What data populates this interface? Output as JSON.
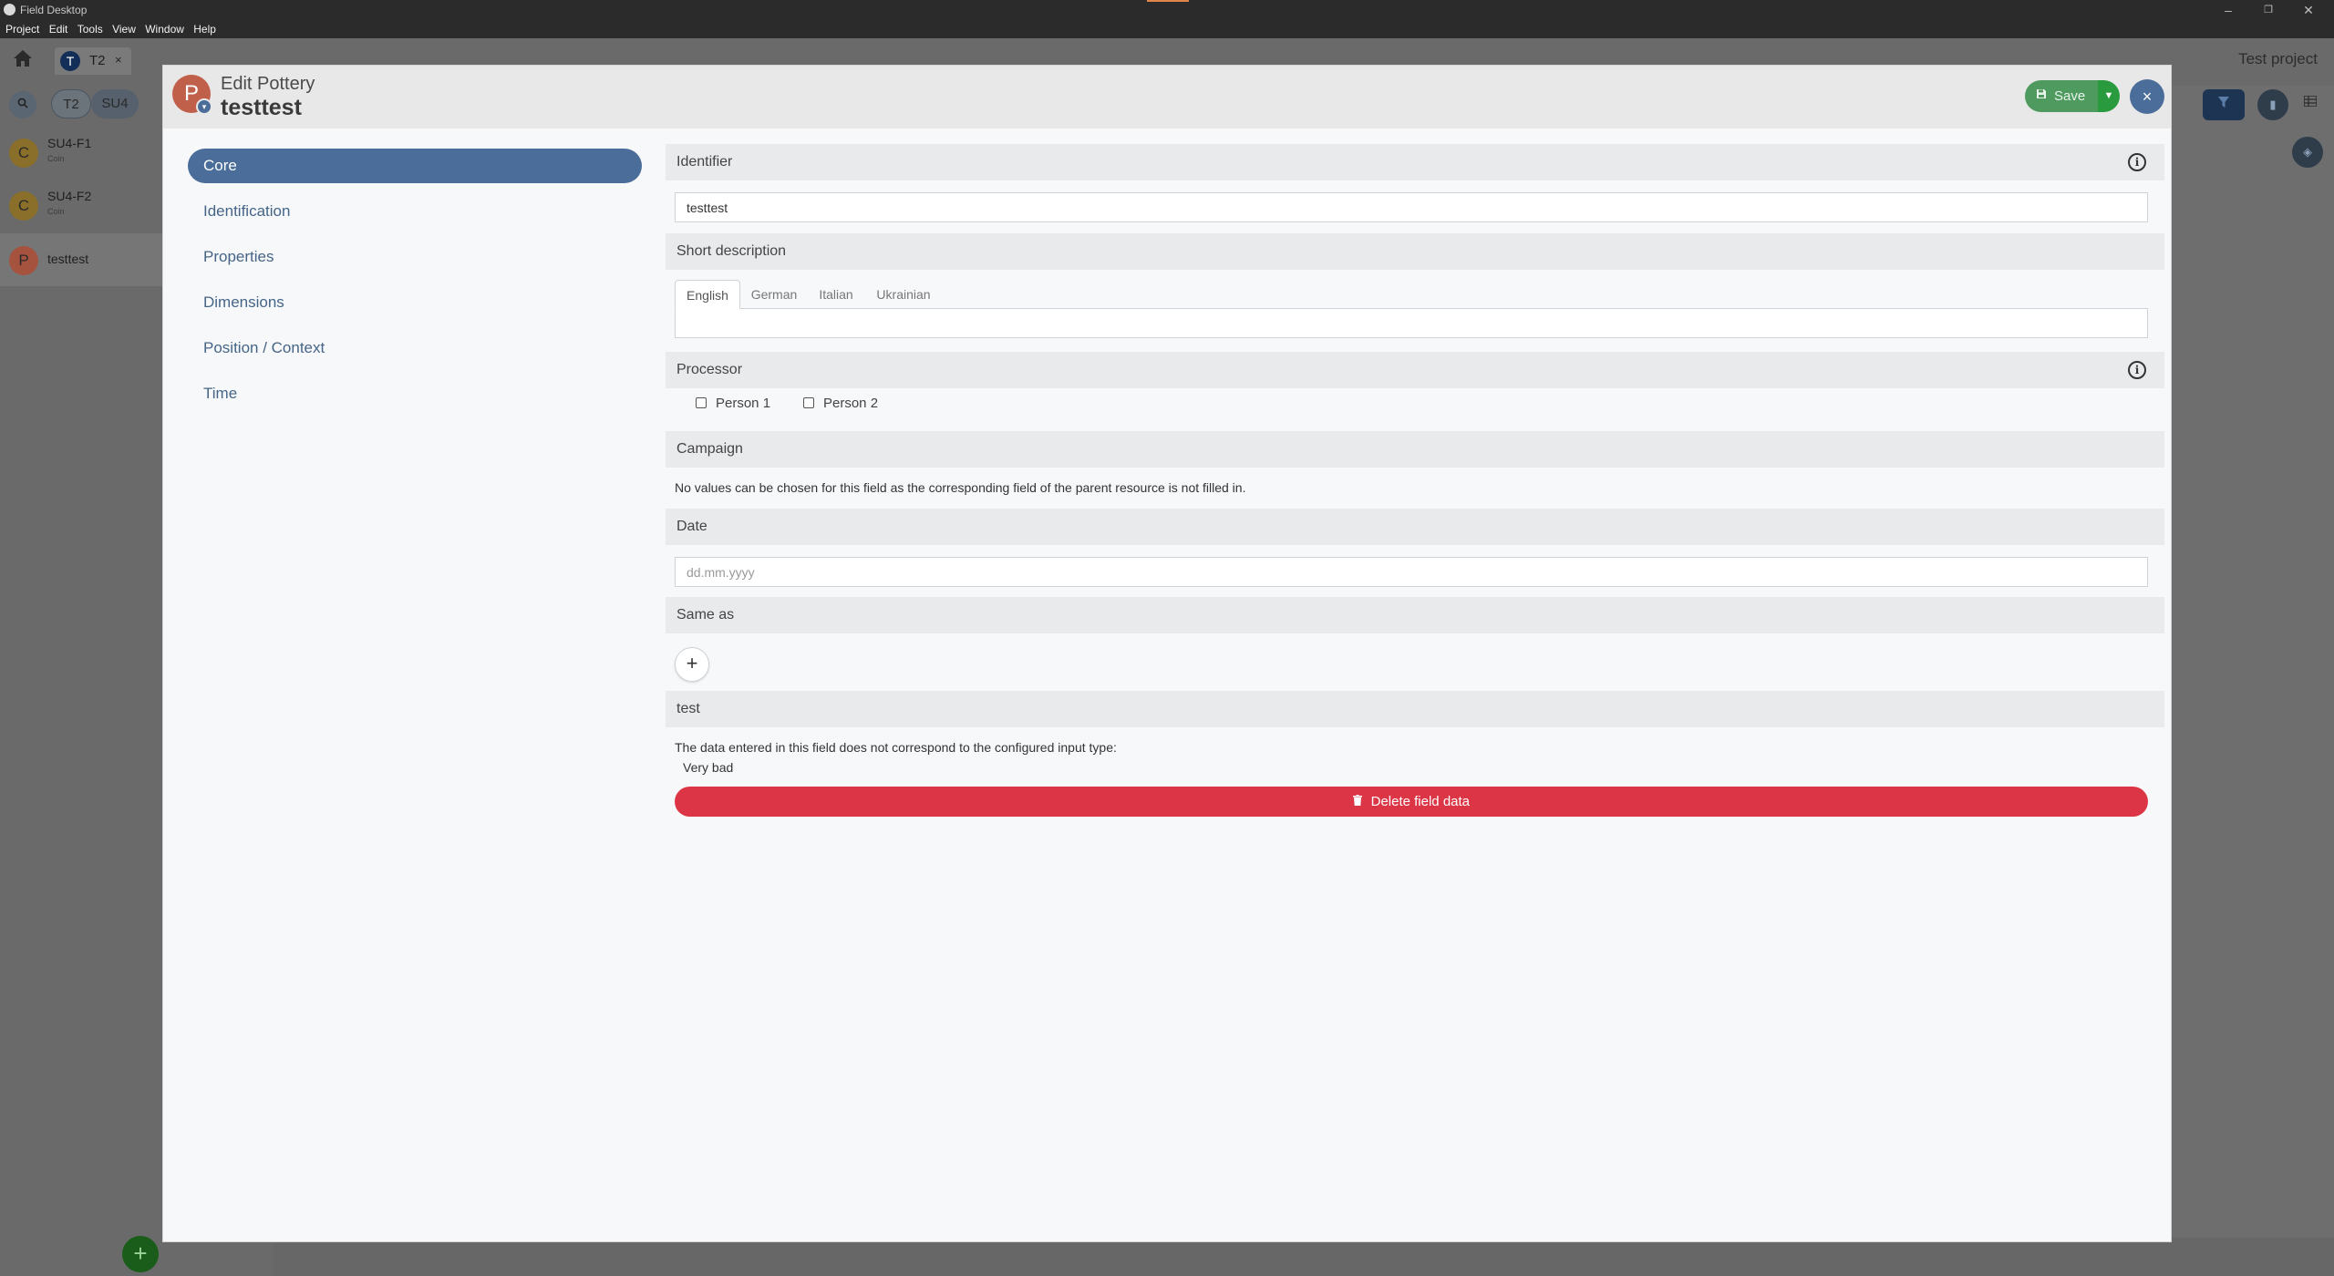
{
  "window": {
    "app_title": "Field Desktop",
    "menu": [
      "Project",
      "Edit",
      "Tools",
      "View",
      "Window",
      "Help"
    ],
    "controls": [
      "minimize-icon",
      "restore-icon",
      "close-icon"
    ]
  },
  "background": {
    "project_tab": {
      "badge": "T",
      "label": "T2",
      "close": "×"
    },
    "project_name": "Test project",
    "breadcrumbs": [
      "T2",
      "SU4"
    ],
    "list": [
      {
        "badge": "C",
        "title": "SU4-F1",
        "subtitle": "Coin",
        "color": "#8a6f2a"
      },
      {
        "badge": "C",
        "title": "SU4-F2",
        "subtitle": "Coin",
        "color": "#8a6f2a"
      },
      {
        "badge": "P",
        "title": "testtest",
        "subtitle": "",
        "color": "#a5533f"
      }
    ],
    "add_button": "+"
  },
  "modal": {
    "header": {
      "category_badge": "P",
      "type_label": "Edit Pottery",
      "identifier": "testtest",
      "save_label": "Save",
      "close_label": "×"
    },
    "groups": [
      "Core",
      "Identification",
      "Properties",
      "Dimensions",
      "Position / Context",
      "Time"
    ],
    "active_group": "Core",
    "fields": {
      "identifier": {
        "label": "Identifier",
        "value": "testtest"
      },
      "short_description": {
        "label": "Short description",
        "languages": [
          "English",
          "German",
          "Italian",
          "Ukrainian"
        ],
        "active_language": "English",
        "value": ""
      },
      "processor": {
        "label": "Processor",
        "options": [
          "Person 1",
          "Person 2"
        ]
      },
      "campaign": {
        "label": "Campaign",
        "message": "No values can be chosen for this field as the corresponding field of the parent resource is not filled in."
      },
      "date": {
        "label": "Date",
        "placeholder": "dd.mm.yyyy",
        "value": ""
      },
      "same_as": {
        "label": "Same as",
        "add_label": "+"
      },
      "test": {
        "label": "test",
        "message": "The data entered in this field does not correspond to the configured input type:",
        "value": "Very bad",
        "delete_label": "Delete field data"
      }
    }
  },
  "colors": {
    "accent": "#4b6d99",
    "save": "#4f9a5f",
    "danger": "#dc3545"
  }
}
